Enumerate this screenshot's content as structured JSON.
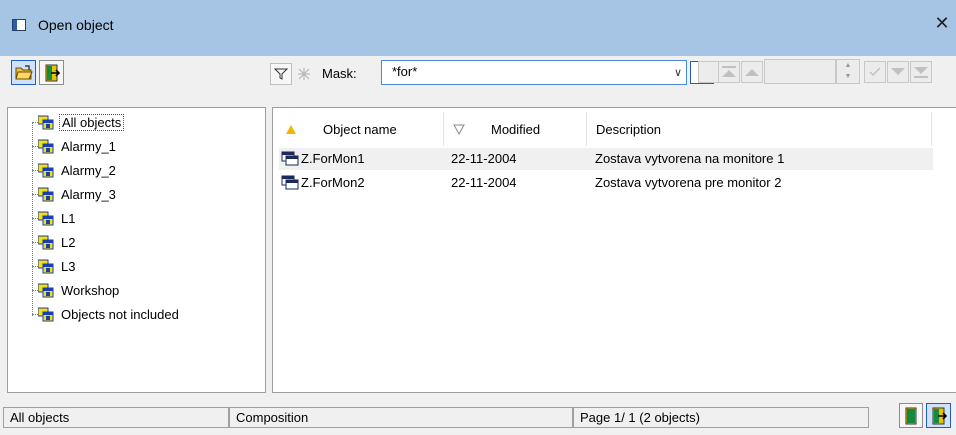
{
  "window": {
    "title": "Open object",
    "close_glyph": "✕"
  },
  "toolbar": {
    "open_icon": "folder-open-icon",
    "exit_icon": "exit-icon",
    "filter_icon": "filter-icon",
    "clear_filter_icon": "clear-filter-icon",
    "mask_label": "Mask:",
    "mask_value": "*for*",
    "confirm_glyph": "✓",
    "nav_first_icon": "first-icon",
    "nav_prev_icon": "prev-icon",
    "nav_next_icon": "next-icon",
    "nav_last_icon": "last-icon"
  },
  "tree": {
    "items": [
      {
        "label": "All objects",
        "selected": true
      },
      {
        "label": "Alarmy_1"
      },
      {
        "label": "Alarmy_2"
      },
      {
        "label": "Alarmy_3"
      },
      {
        "label": "L1"
      },
      {
        "label": "L2"
      },
      {
        "label": "L3"
      },
      {
        "label": "Workshop"
      },
      {
        "label": "Objects not included"
      }
    ]
  },
  "list": {
    "columns": [
      {
        "label": "Object name",
        "sort": "asc-active"
      },
      {
        "label": "Modified",
        "sort": "desc"
      },
      {
        "label": "Description"
      }
    ],
    "rows": [
      {
        "name": "Z.ForMon1",
        "modified": "22-11-2004",
        "description": "Zostava vytvorena na monitore 1"
      },
      {
        "name": "Z.ForMon2",
        "modified": "22-11-2004",
        "description": "Zostava vytvorena pre monitor 2"
      }
    ]
  },
  "status": {
    "scope": "All objects",
    "type": "Composition",
    "page": "Page  1/ 1  (2 objects)"
  },
  "colors": {
    "titlebar": "#a6c4e4",
    "accent": "#4a88d8",
    "icon_yellow": "#f4e300",
    "icon_blue": "#1a3cb4"
  }
}
